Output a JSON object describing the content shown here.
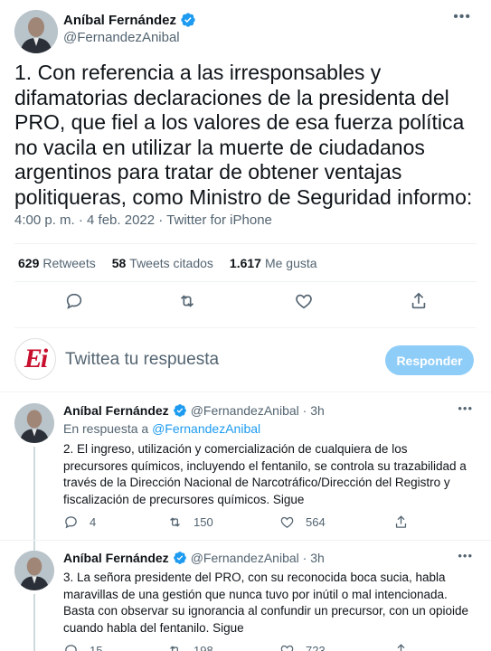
{
  "main_tweet": {
    "author_name": "Aníbal Fernández",
    "author_handle": "@FernandezAnibal",
    "text": "1. Con referencia a las irresponsables y difamatorias declaraciones de la presidenta del PRO, que fiel a los valores de esa fuerza política no vacila en utilizar la muerte de ciudadanos argentinos para tratar de obtener ventajas politiqueras, como Ministro de Seguridad informo:",
    "timestamp": "4:00 p. m. · 4 feb. 2022 · Twitter for iPhone",
    "stats": {
      "retweets_count": "629",
      "retweets_label": "Retweets",
      "quotes_count": "58",
      "quotes_label": "Tweets citados",
      "likes_count": "1.617",
      "likes_label": "Me gusta"
    }
  },
  "reply_box": {
    "avatar_text": "Ei",
    "placeholder": "Twittea tu respuesta",
    "button_label": "Responder"
  },
  "thread": [
    {
      "author_name": "Aníbal Fernández",
      "author_handle": "@FernandezAnibal · 3h",
      "reply_to_prefix": "En respuesta a",
      "reply_to_handle": "@FernandezAnibal",
      "text": "2. El ingreso, utilización y comercialización de cualquiera de los precursores químicos, incluyendo el fentanilo, se controla su trazabilidad a través de la Dirección Nacional de Narcotráfico/Dirección del Registro y fiscalización de precursores químicos. Sigue",
      "replies": "4",
      "retweets": "150",
      "likes": "564"
    },
    {
      "author_name": "Aníbal Fernández",
      "author_handle": "@FernandezAnibal · 3h",
      "text": "3. La señora presidente del PRO, con su reconocida boca sucia, habla maravillas de una gestión que nunca tuvo por inútil o mal intencionada. Basta con observar su ignorancia al confundir un precursor, con un opioide cuando habla del fentanilo. Sigue",
      "replies": "15",
      "retweets": "198",
      "likes": "723"
    }
  ],
  "colors": {
    "accent": "#1d9bf0",
    "muted": "#536471",
    "button_disabled": "#8ecdf8",
    "logo_red": "#c8102e"
  },
  "icons": [
    "verified-badge-icon",
    "more-options-icon",
    "reply-icon",
    "retweet-icon",
    "like-icon",
    "share-icon"
  ]
}
